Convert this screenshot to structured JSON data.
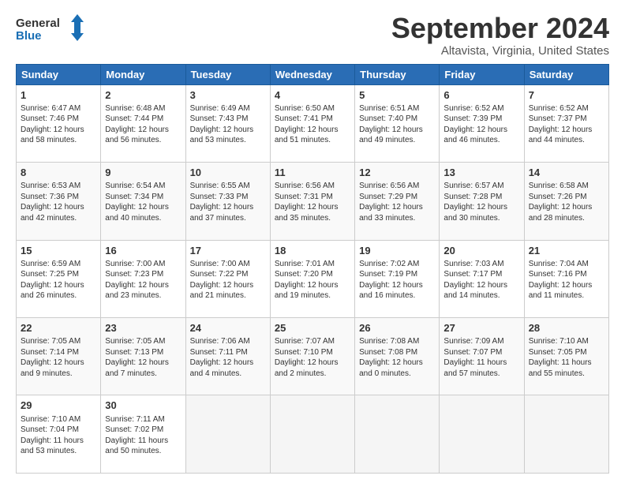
{
  "header": {
    "logo_general": "General",
    "logo_blue": "Blue",
    "month": "September 2024",
    "location": "Altavista, Virginia, United States"
  },
  "weekdays": [
    "Sunday",
    "Monday",
    "Tuesday",
    "Wednesday",
    "Thursday",
    "Friday",
    "Saturday"
  ],
  "rows": [
    [
      {
        "day": "1",
        "lines": [
          "Sunrise: 6:47 AM",
          "Sunset: 7:46 PM",
          "Daylight: 12 hours",
          "and 58 minutes."
        ]
      },
      {
        "day": "2",
        "lines": [
          "Sunrise: 6:48 AM",
          "Sunset: 7:44 PM",
          "Daylight: 12 hours",
          "and 56 minutes."
        ]
      },
      {
        "day": "3",
        "lines": [
          "Sunrise: 6:49 AM",
          "Sunset: 7:43 PM",
          "Daylight: 12 hours",
          "and 53 minutes."
        ]
      },
      {
        "day": "4",
        "lines": [
          "Sunrise: 6:50 AM",
          "Sunset: 7:41 PM",
          "Daylight: 12 hours",
          "and 51 minutes."
        ]
      },
      {
        "day": "5",
        "lines": [
          "Sunrise: 6:51 AM",
          "Sunset: 7:40 PM",
          "Daylight: 12 hours",
          "and 49 minutes."
        ]
      },
      {
        "day": "6",
        "lines": [
          "Sunrise: 6:52 AM",
          "Sunset: 7:39 PM",
          "Daylight: 12 hours",
          "and 46 minutes."
        ]
      },
      {
        "day": "7",
        "lines": [
          "Sunrise: 6:52 AM",
          "Sunset: 7:37 PM",
          "Daylight: 12 hours",
          "and 44 minutes."
        ]
      }
    ],
    [
      {
        "day": "8",
        "lines": [
          "Sunrise: 6:53 AM",
          "Sunset: 7:36 PM",
          "Daylight: 12 hours",
          "and 42 minutes."
        ]
      },
      {
        "day": "9",
        "lines": [
          "Sunrise: 6:54 AM",
          "Sunset: 7:34 PM",
          "Daylight: 12 hours",
          "and 40 minutes."
        ]
      },
      {
        "day": "10",
        "lines": [
          "Sunrise: 6:55 AM",
          "Sunset: 7:33 PM",
          "Daylight: 12 hours",
          "and 37 minutes."
        ]
      },
      {
        "day": "11",
        "lines": [
          "Sunrise: 6:56 AM",
          "Sunset: 7:31 PM",
          "Daylight: 12 hours",
          "and 35 minutes."
        ]
      },
      {
        "day": "12",
        "lines": [
          "Sunrise: 6:56 AM",
          "Sunset: 7:29 PM",
          "Daylight: 12 hours",
          "and 33 minutes."
        ]
      },
      {
        "day": "13",
        "lines": [
          "Sunrise: 6:57 AM",
          "Sunset: 7:28 PM",
          "Daylight: 12 hours",
          "and 30 minutes."
        ]
      },
      {
        "day": "14",
        "lines": [
          "Sunrise: 6:58 AM",
          "Sunset: 7:26 PM",
          "Daylight: 12 hours",
          "and 28 minutes."
        ]
      }
    ],
    [
      {
        "day": "15",
        "lines": [
          "Sunrise: 6:59 AM",
          "Sunset: 7:25 PM",
          "Daylight: 12 hours",
          "and 26 minutes."
        ]
      },
      {
        "day": "16",
        "lines": [
          "Sunrise: 7:00 AM",
          "Sunset: 7:23 PM",
          "Daylight: 12 hours",
          "and 23 minutes."
        ]
      },
      {
        "day": "17",
        "lines": [
          "Sunrise: 7:00 AM",
          "Sunset: 7:22 PM",
          "Daylight: 12 hours",
          "and 21 minutes."
        ]
      },
      {
        "day": "18",
        "lines": [
          "Sunrise: 7:01 AM",
          "Sunset: 7:20 PM",
          "Daylight: 12 hours",
          "and 19 minutes."
        ]
      },
      {
        "day": "19",
        "lines": [
          "Sunrise: 7:02 AM",
          "Sunset: 7:19 PM",
          "Daylight: 12 hours",
          "and 16 minutes."
        ]
      },
      {
        "day": "20",
        "lines": [
          "Sunrise: 7:03 AM",
          "Sunset: 7:17 PM",
          "Daylight: 12 hours",
          "and 14 minutes."
        ]
      },
      {
        "day": "21",
        "lines": [
          "Sunrise: 7:04 AM",
          "Sunset: 7:16 PM",
          "Daylight: 12 hours",
          "and 11 minutes."
        ]
      }
    ],
    [
      {
        "day": "22",
        "lines": [
          "Sunrise: 7:05 AM",
          "Sunset: 7:14 PM",
          "Daylight: 12 hours",
          "and 9 minutes."
        ]
      },
      {
        "day": "23",
        "lines": [
          "Sunrise: 7:05 AM",
          "Sunset: 7:13 PM",
          "Daylight: 12 hours",
          "and 7 minutes."
        ]
      },
      {
        "day": "24",
        "lines": [
          "Sunrise: 7:06 AM",
          "Sunset: 7:11 PM",
          "Daylight: 12 hours",
          "and 4 minutes."
        ]
      },
      {
        "day": "25",
        "lines": [
          "Sunrise: 7:07 AM",
          "Sunset: 7:10 PM",
          "Daylight: 12 hours",
          "and 2 minutes."
        ]
      },
      {
        "day": "26",
        "lines": [
          "Sunrise: 7:08 AM",
          "Sunset: 7:08 PM",
          "Daylight: 12 hours",
          "and 0 minutes."
        ]
      },
      {
        "day": "27",
        "lines": [
          "Sunrise: 7:09 AM",
          "Sunset: 7:07 PM",
          "Daylight: 11 hours",
          "and 57 minutes."
        ]
      },
      {
        "day": "28",
        "lines": [
          "Sunrise: 7:10 AM",
          "Sunset: 7:05 PM",
          "Daylight: 11 hours",
          "and 55 minutes."
        ]
      }
    ],
    [
      {
        "day": "29",
        "lines": [
          "Sunrise: 7:10 AM",
          "Sunset: 7:04 PM",
          "Daylight: 11 hours",
          "and 53 minutes."
        ]
      },
      {
        "day": "30",
        "lines": [
          "Sunrise: 7:11 AM",
          "Sunset: 7:02 PM",
          "Daylight: 11 hours",
          "and 50 minutes."
        ]
      },
      {
        "day": "",
        "lines": []
      },
      {
        "day": "",
        "lines": []
      },
      {
        "day": "",
        "lines": []
      },
      {
        "day": "",
        "lines": []
      },
      {
        "day": "",
        "lines": []
      }
    ]
  ]
}
